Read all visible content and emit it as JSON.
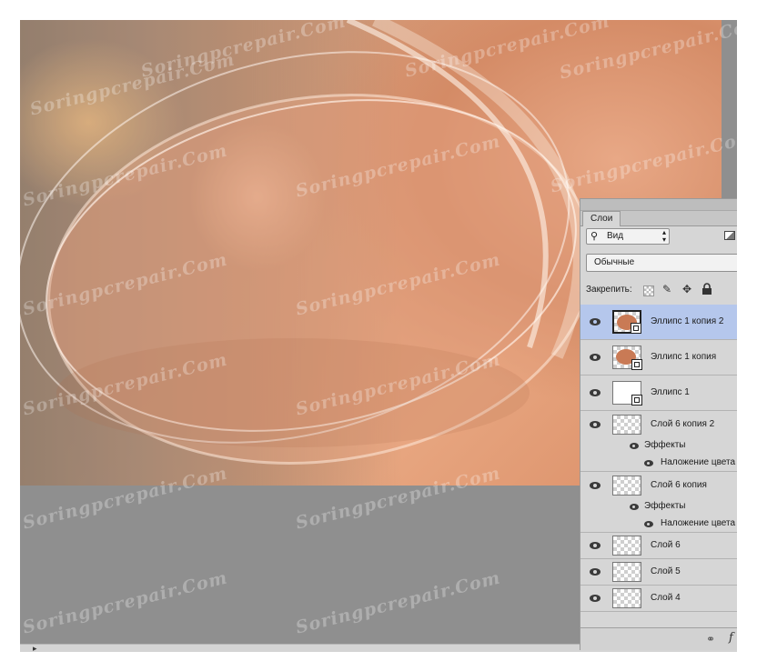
{
  "panel": {
    "tab_label": "Слои",
    "filter_label": "Вид",
    "blend_mode": "Обычные",
    "lock_label": "Закрепить:"
  },
  "icons": {
    "filter_search": "search-icon",
    "filter_arrows": "up-down-arrows-icon",
    "visibility": "eye-icon",
    "lock_brush": "brush-icon",
    "lock_move": "move-arrows-icon",
    "lock_all": "padlock-icon",
    "link": "link-icon",
    "fx": "fx-icon"
  },
  "glyphs": {
    "search": "⚲",
    "arrows": "▴▾",
    "brush": "✎",
    "move": "✥",
    "lock": "🔒",
    "link": "⚭",
    "fx": "f"
  },
  "layers": [
    {
      "name": "Эллипс 1 копия 2",
      "selected": true,
      "thumb": "ellipse-shape"
    },
    {
      "name": "Эллипс 1 копия",
      "selected": false,
      "thumb": "ellipse-shape"
    },
    {
      "name": "Эллипс 1",
      "selected": false,
      "thumb": "ellipse-shape-white"
    },
    {
      "name": "Слой 6 копия 2",
      "selected": false,
      "thumb": "transparent",
      "effects_label": "Эффекты",
      "effect": "Наложение цвета"
    },
    {
      "name": "Слой 6 копия",
      "selected": false,
      "thumb": "transparent",
      "effects_label": "Эффекты",
      "effect": "Наложение цвета"
    },
    {
      "name": "Слой 6",
      "selected": false,
      "thumb": "transparent"
    },
    {
      "name": "Слой 5",
      "selected": false,
      "thumb": "transparent"
    },
    {
      "name": "Слой 4",
      "selected": false,
      "thumb": "transparent"
    }
  ],
  "watermark_text": "Soringpcrepair.Com",
  "colors": {
    "canvas_peach": "#d8916b",
    "workspace_gray": "#8f8f8f",
    "selection_blue": "#b5c7ec",
    "panel_gray": "#d6d6d6"
  }
}
